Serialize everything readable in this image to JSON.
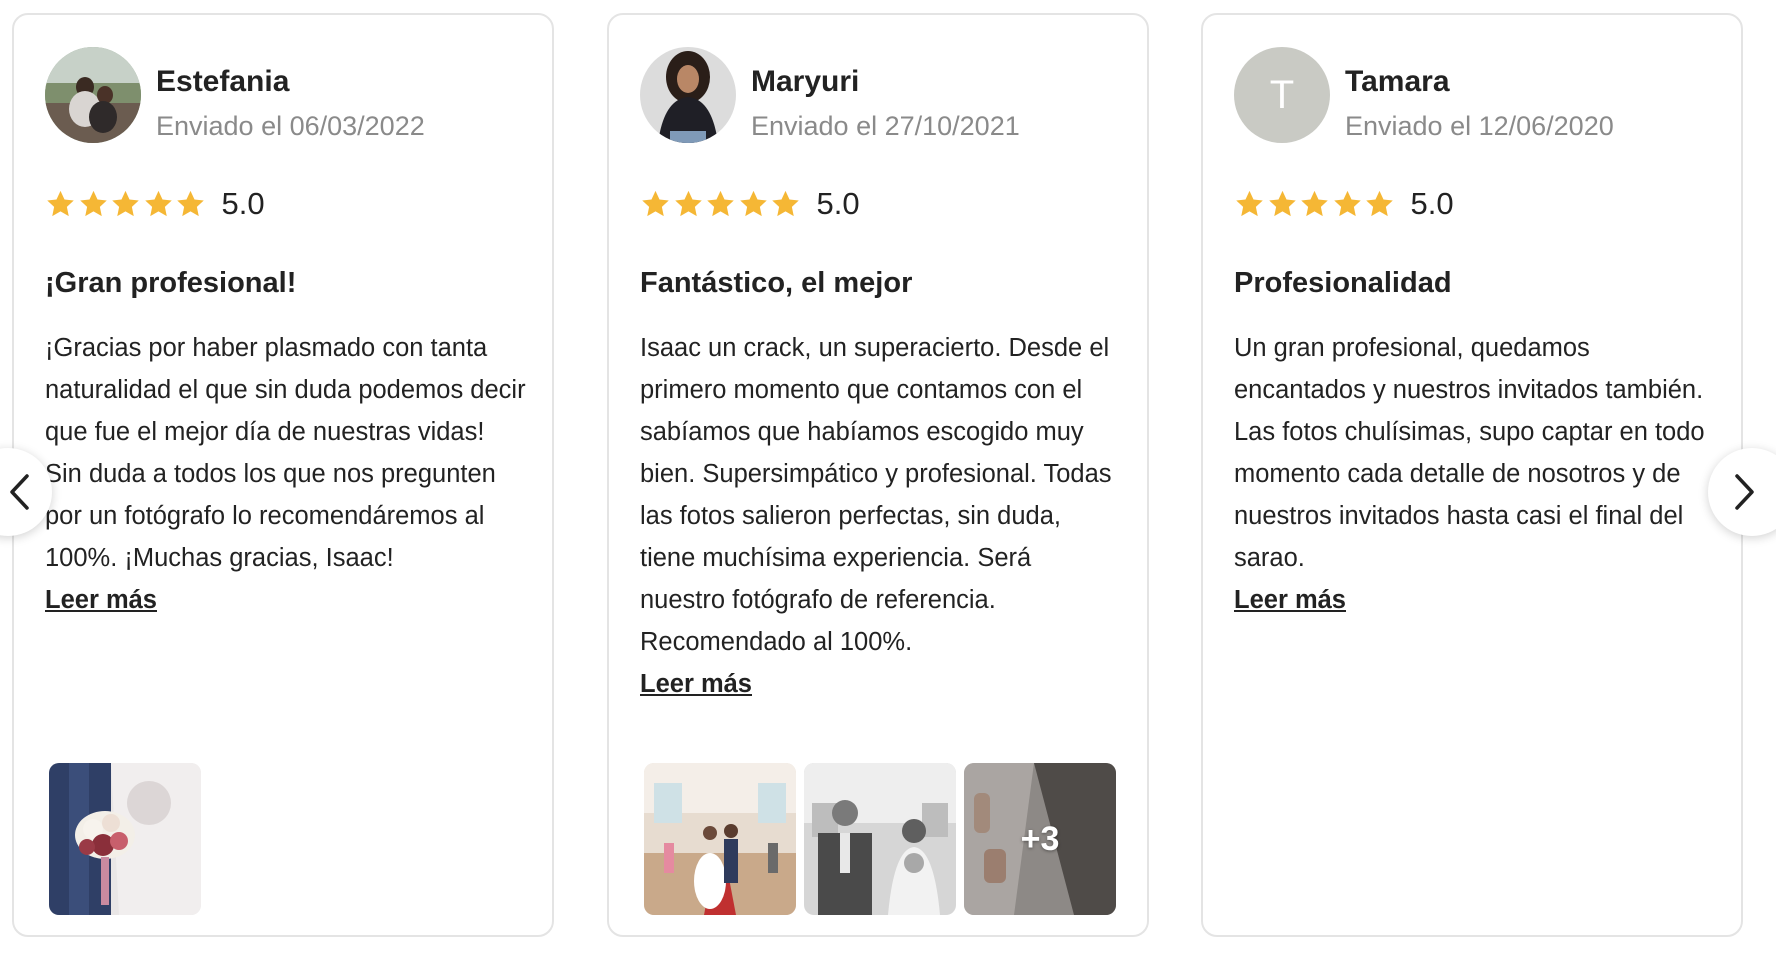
{
  "accent": {
    "star": "#f5b735",
    "avatar_letter_bg": "#c9cac4"
  },
  "reviews": [
    {
      "author": "Estefania",
      "date": "Enviado el 06/03/2022",
      "rating": 5,
      "score": "5.0",
      "title": "¡Gran profesional!",
      "body": "¡Gracias por haber plasmado con tanta naturalidad el que sin duda podemos decir que fue el mejor día de nuestras vidas! Sin duda a todos los que nos pregunten por un fotógrafo lo recomendáremos al 100%. ¡Muchas gracias, Isaac!",
      "read_more": "Leer más"
    },
    {
      "author": "Maryuri",
      "date": "Enviado el 27/10/2021",
      "rating": 5,
      "score": "5.0",
      "title": "Fantástico, el mejor",
      "body": "Isaac un crack, un superacierto. Desde el primero momento que contamos con el sabíamos que habíamos escogido muy bien. Supersimpático y profesional. Todas las fotos salieron perfectas, sin duda, tiene muchísima experiencia. Será nuestro fotógrafo de referencia. Recomendado al 100%.",
      "read_more": "Leer más",
      "more_photos": "+3"
    },
    {
      "author": "Tamara",
      "avatar_letter": "T",
      "date": "Enviado el 12/06/2020",
      "rating": 5,
      "score": "5.0",
      "title": "Profesionalidad",
      "body": "Un gran profesional, quedamos encantados y nuestros invitados también. Las fotos chulísimas, supo captar en todo momento cada detalle de nosotros y de nuestros invitados hasta casi el final del sarao.",
      "read_more": "Leer más"
    }
  ],
  "nav": {
    "prev_icon": "chevron-left-icon",
    "next_icon": "chevron-right-icon"
  }
}
